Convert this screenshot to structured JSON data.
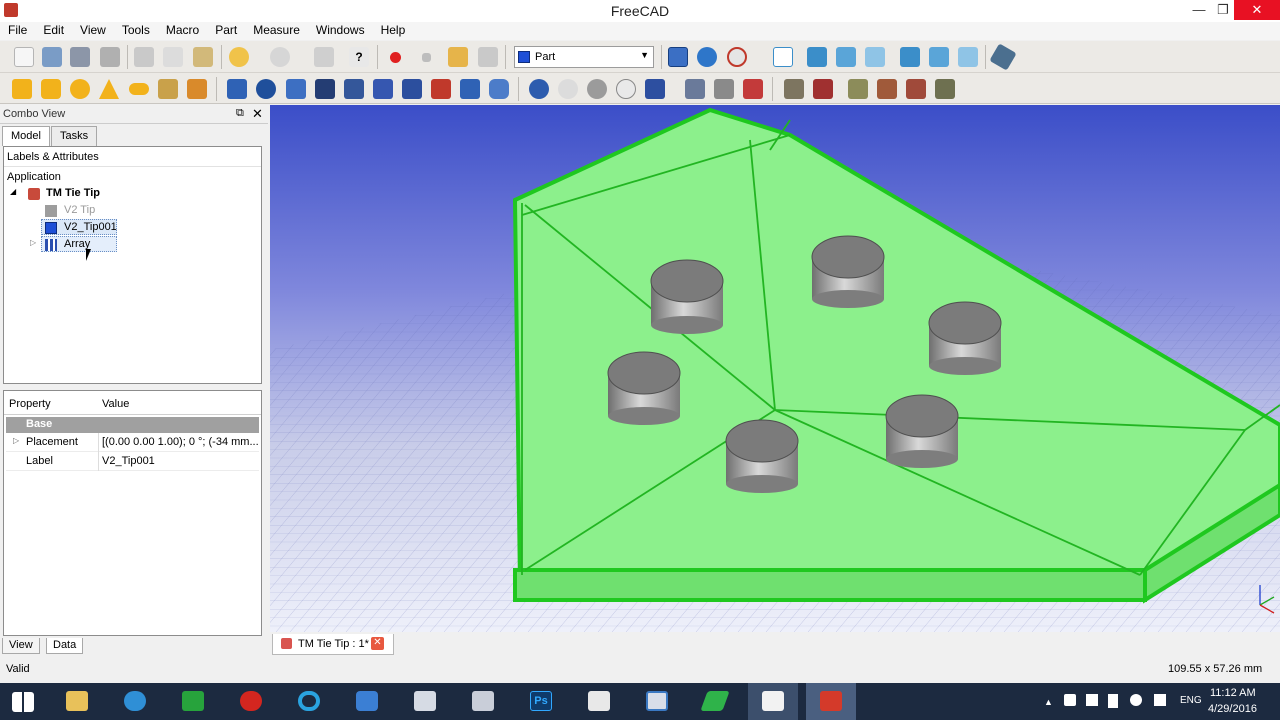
{
  "window": {
    "title": "FreeCAD",
    "minimize": "—",
    "restore": "❐",
    "close": "✕"
  },
  "menu": [
    "File",
    "Edit",
    "View",
    "Tools",
    "Macro",
    "Part",
    "Measure",
    "Windows",
    "Help"
  ],
  "workbench": {
    "selected": "Part",
    "arrow": "▼"
  },
  "combo_view": {
    "title": "Combo View",
    "float_icon": "⧉",
    "close_icon": "✕",
    "tabs": [
      "Model",
      "Tasks"
    ],
    "tree_header": "Labels & Attributes",
    "application_label": "Application",
    "document": "TM Tie Tip",
    "items": [
      {
        "label": "V2 Tip",
        "icon": "tip-icon",
        "dimmed": true
      },
      {
        "label": "V2_Tip001",
        "icon": "part-cube-icon",
        "selected": true
      },
      {
        "label": "Array",
        "icon": "array-icon",
        "expandable": true
      }
    ]
  },
  "properties": {
    "header_property": "Property",
    "header_value": "Value",
    "group": "Base",
    "rows": [
      {
        "name": "Placement",
        "value": "[(0.00 0.00 1.00); 0 °; (-34 mm...",
        "expandable": true
      },
      {
        "name": "Label",
        "value": "V2_Tip001"
      }
    ],
    "bottom_tabs": [
      "View",
      "Data"
    ]
  },
  "document_tab": {
    "label": "TM Tie Tip : 1*",
    "close": "✕"
  },
  "status": {
    "left": "Valid",
    "right": "109.55 x 57.26 mm"
  },
  "taskbar": {
    "apps": [
      "start-button",
      "file-explorer",
      "internet-explorer",
      "store",
      "mcafee",
      "circle-app",
      "molecule-app",
      "calculator",
      "graph-app",
      "photoshop",
      "window-app",
      "document-app",
      "pen-app",
      "folder-app",
      "freecad"
    ],
    "photoshop_label": "Ps",
    "clock_time": "11:12 AM",
    "clock_date": "4/29/2016",
    "language": "ENG"
  },
  "colors": {
    "accent": "#e81123",
    "model_green": "#8cf08c",
    "edge_green": "#22c322",
    "viewport_top": "#3b4ec8"
  }
}
